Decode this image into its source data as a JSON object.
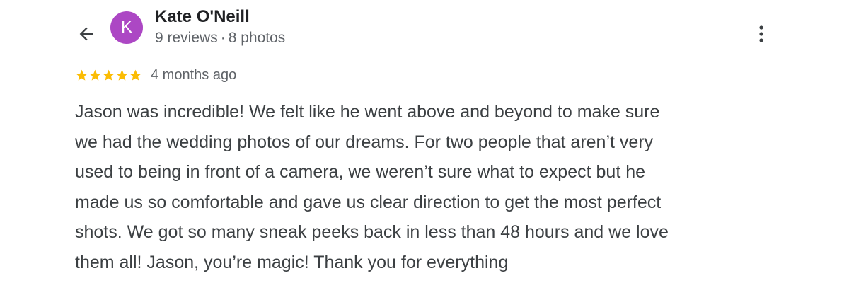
{
  "review": {
    "author": {
      "initial": "K",
      "name": "Kate O'Neill",
      "reviews": "9 reviews",
      "separator": "·",
      "photos": "8 photos",
      "avatar_color": "#ac47c4"
    },
    "rating": {
      "stars": 5,
      "max": 5,
      "star_color": "#fbbc04",
      "time_ago": "4 months ago"
    },
    "text": "Jason was incredible! We felt like he went above and beyond to make sure\nwe had the wedding photos of our dreams. For two people that aren’t very\nused to being in front of a camera, we weren’t sure what to expect but he\nmade us so comfortable and gave us clear direction to get the most perfect\nshots. We got so many sneak peeks back in less than 48 hours and we love\nthem all! Jason, you’re magic! Thank you for everything"
  },
  "icons": {
    "back": "arrow-left-icon",
    "more": "more-vertical-icon",
    "star": "star-icon"
  }
}
